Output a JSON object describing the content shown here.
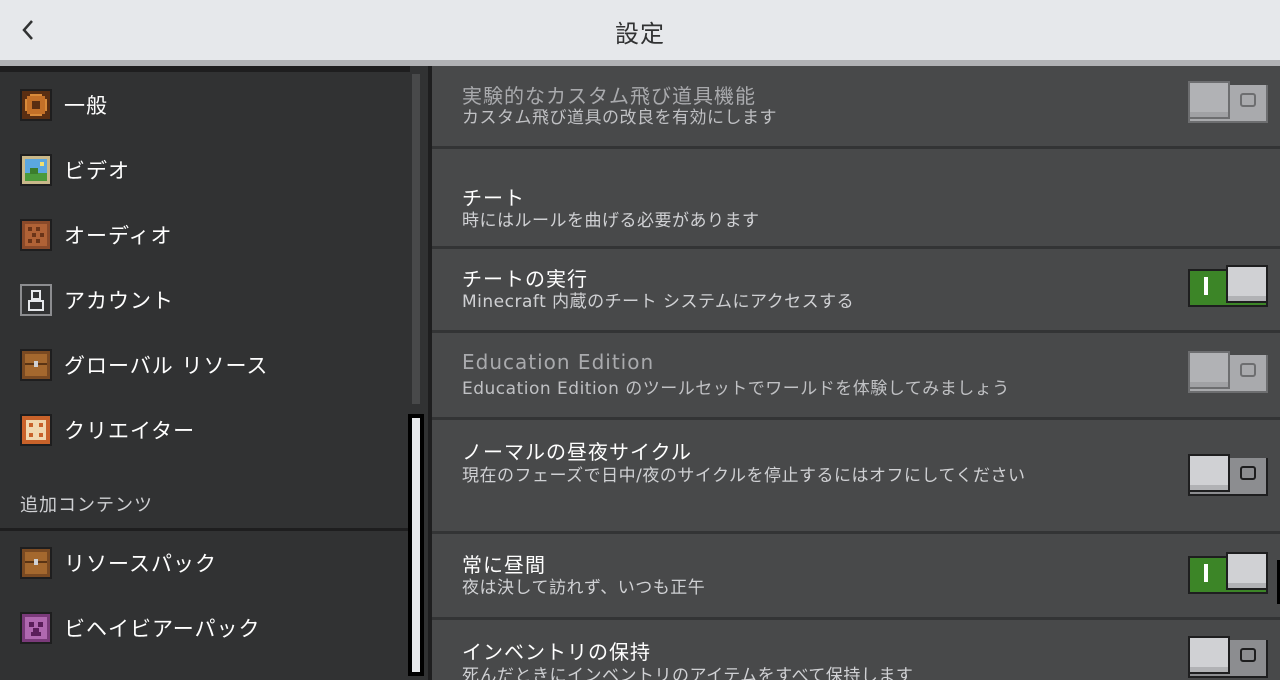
{
  "header": {
    "title": "設定"
  },
  "sidebar": {
    "items": [
      {
        "label": "一般",
        "icon": "gear-icon"
      },
      {
        "label": "ビデオ",
        "icon": "picture-icon"
      },
      {
        "label": "オーディオ",
        "icon": "noteblock-icon"
      },
      {
        "label": "アカウント",
        "icon": "person-icon"
      },
      {
        "label": "グローバル リソース",
        "icon": "chest-icon"
      },
      {
        "label": "クリエイター",
        "icon": "dice-icon"
      }
    ],
    "section_header": "追加コンテンツ",
    "content_items": [
      {
        "label": "リソースパック",
        "icon": "chest-icon"
      },
      {
        "label": "ビヘイビアーパック",
        "icon": "creeper-icon"
      }
    ]
  },
  "settings": [
    {
      "title": "実験的なカスタム飛び道具機能",
      "desc": "カスタム飛び道具の改良を有効にします",
      "toggle": "off",
      "disabled": true
    },
    {
      "title": "チート",
      "desc": "時にはルールを曲げる必要があります",
      "toggle": null
    },
    {
      "title": "チートの実行",
      "desc": "Minecraft 内蔵のチート システムにアクセスする",
      "toggle": "on"
    },
    {
      "title": "Education Edition",
      "desc": "Education Edition のツールセットでワールドを体験してみましょう",
      "toggle": "off",
      "disabled": true
    },
    {
      "title": "ノーマルの昼夜サイクル",
      "desc": "現在のフェーズで日中/夜のサイクルを停止するにはオフにしてください",
      "toggle": "off"
    },
    {
      "title": "常に昼間",
      "desc": "夜は決して訪れず、いつも正午",
      "toggle": "on"
    },
    {
      "title": "インベントリの保持",
      "desc": "死んだときにインベントリのアイテムをすべて保持します",
      "toggle": "off"
    }
  ],
  "colors": {
    "header_bg": "#e6e8eb",
    "panel_bg": "#48494a",
    "sidebar_bg": "#313233",
    "toggle_on": "#3c8527"
  }
}
